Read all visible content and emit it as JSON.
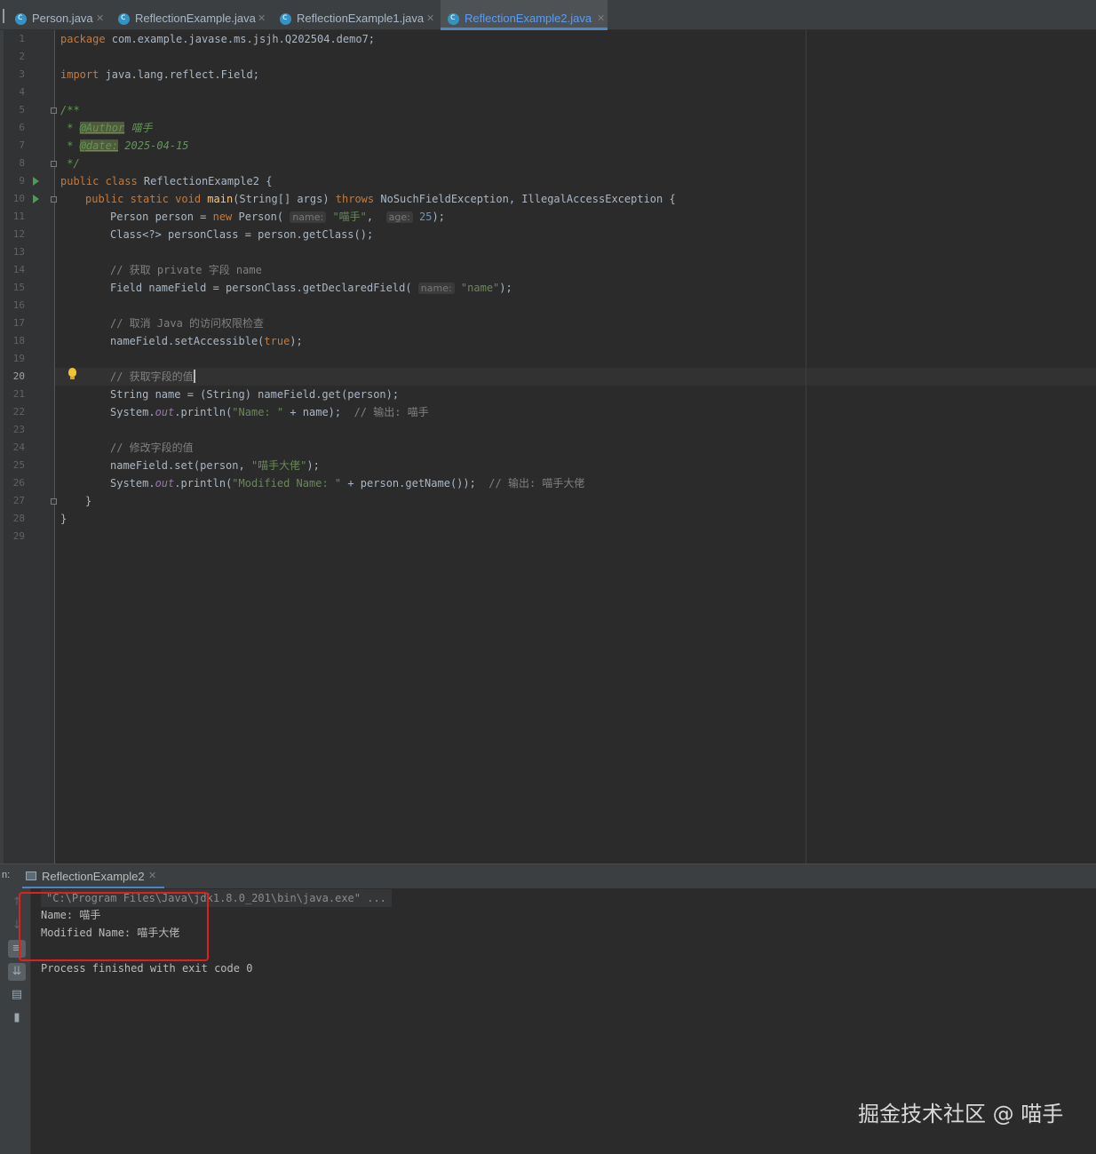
{
  "tabs": [
    {
      "label": "Person.java",
      "active": false
    },
    {
      "label": "ReflectionExample.java",
      "active": false
    },
    {
      "label": "ReflectionExample1.java",
      "active": false
    },
    {
      "label": "ReflectionExample2.java",
      "active": true
    }
  ],
  "editor": {
    "current_line": "20",
    "line_numbers": [
      "1",
      "2",
      "3",
      "4",
      "5",
      "6",
      "7",
      "8",
      "9",
      "10",
      "11",
      "12",
      "13",
      "14",
      "15",
      "16",
      "17",
      "18",
      "19",
      "20",
      "21",
      "22",
      "23",
      "24",
      "25",
      "26",
      "27",
      "28",
      "29"
    ],
    "code": {
      "l1_kw": "package",
      "l1_rest": " com.example.javase.ms.jsjh.Q202504.demo7;",
      "l3_kw": "import",
      "l3_rest": " java.lang.reflect.Field;",
      "l5": "/**",
      "l6_star": " * ",
      "l6_tag": "@Author",
      "l6_val": " 喵手",
      "l7_star": " * ",
      "l7_tag": "@date:",
      "l7_val": " 2025-04-15",
      "l8": " */",
      "l9_kw": "public class",
      "l9_rest": " ReflectionExample2 {",
      "l10_kw": "public static void",
      "l10_fn": "main",
      "l10_mid": "(String[] args) ",
      "l10_kw2": "throws",
      "l10_rest": " NoSuchFieldException, IllegalAccessException {",
      "l11_a": "Person person = ",
      "l11_kw": "new",
      "l11_b": " Person( ",
      "l11_hint1": "name:",
      "l11_str": "\"喵手\"",
      "l11_c": ", ",
      "l11_hint2": "age:",
      "l11_num": "25",
      "l11_d": ");",
      "l12": "Class<?> personClass = person.getClass();",
      "l14": "// 获取 private 字段 name",
      "l15_a": "Field nameField = personClass.getDeclaredField( ",
      "l15_hint": "name:",
      "l15_str": "\"name\"",
      "l15_b": ");",
      "l17": "// 取消 Java 的访问权限检查",
      "l18_a": "nameField.setAccessible(",
      "l18_kw": "true",
      "l18_b": ");",
      "l20": "// 获取字段的值",
      "l21": "String name = (String) nameField.get(person);",
      "l22_a": "System.",
      "l22_fld": "out",
      "l22_b": ".println(",
      "l22_str": "\"Name: \"",
      "l22_c": " + name);  ",
      "l22_cm": "// 输出: 喵手",
      "l24": "// 修改字段的值",
      "l25_a": "nameField.set(person, ",
      "l25_str": "\"喵手大佬\"",
      "l25_b": ");",
      "l26_a": "System.",
      "l26_fld": "out",
      "l26_b": ".println(",
      "l26_str": "\"Modified Name: \"",
      "l26_c": " + person.getName());  ",
      "l26_cm": "// 输出: 喵手大佬",
      "l27": "}",
      "l28": "}"
    }
  },
  "run_panel": {
    "side_label": "n:",
    "tab_label": "ReflectionExample2",
    "console": {
      "command": "\"C:\\Program Files\\Java\\jdk1.8.0_201\\bin\\java.exe\" ...",
      "output1": "Name: 喵手",
      "output2": "Modified Name: 喵手大佬",
      "exit": "Process finished with exit code 0"
    }
  },
  "watermark": "掘金技术社区 @ 喵手",
  "colors": {
    "accent": "#4a88c7",
    "highlight_box": "#e0201f"
  }
}
